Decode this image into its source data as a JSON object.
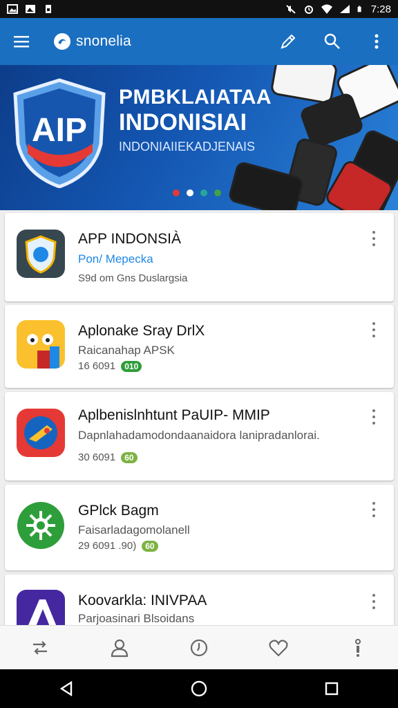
{
  "status_bar": {
    "time": "7:28",
    "left_icons": [
      "image-icon",
      "photo-icon",
      "sim-icon"
    ],
    "right_icons": [
      "no-sound-icon",
      "alarm-icon",
      "wifi-icon",
      "signal-icon",
      "battery-icon"
    ]
  },
  "app_bar": {
    "title": "snonelia",
    "icons": [
      "menu-icon",
      "logo-icon",
      "edit-icon",
      "search-icon",
      "more-vert-icon"
    ]
  },
  "banner": {
    "badge": "AIP",
    "line1": "PMBKLAIATAA",
    "line2": "INDONISIAI",
    "line3": "INDONIAIIEKADJENAIS",
    "dots": [
      "#e53935",
      "#ffffff",
      "#26a69a",
      "#43a047"
    ]
  },
  "apps": [
    {
      "title": "APP INDONSIÀ",
      "subtitle": "Pon/ Mepecka",
      "meta": "S9d om Gns Duslargsia",
      "badge": "",
      "badge_color": "",
      "subtitle_color": "#1e88e5"
    },
    {
      "title": "Aplonake Sray DrlX",
      "subtitle": "Raicanahap APSK",
      "meta": "16 6091",
      "badge": "010",
      "badge_color": "#2e9e3a",
      "subtitle_color": "#555555"
    },
    {
      "title": "Aplbenislnhtunt PaUIP- MMIP",
      "subtitle": "Dapnlahadamodondaanaidora lanipradanlorai.",
      "meta": "30 6091",
      "badge": "60",
      "badge_color": "#7cb342",
      "subtitle_color": "#555555"
    },
    {
      "title": "GPlck Bagm",
      "subtitle": "Faisarladagomolanell",
      "meta": "29 6091 .90)",
      "badge": "60",
      "badge_color": "#7cb342",
      "subtitle_color": "#555555"
    },
    {
      "title": "Koovarkla: INIVPAA",
      "subtitle": "Parjoasinari Blsoidans",
      "meta": "",
      "badge": "",
      "badge_color": "",
      "subtitle_color": "#555555"
    }
  ],
  "bottom_nav": [
    "swap-icon",
    "person-icon",
    "history-icon",
    "heart-icon",
    "info-icon"
  ],
  "system_nav": [
    "back-icon",
    "home-icon",
    "recents-icon"
  ],
  "colors": {
    "app_bar": "#1a6fc0",
    "accent": "#1e88e5"
  }
}
